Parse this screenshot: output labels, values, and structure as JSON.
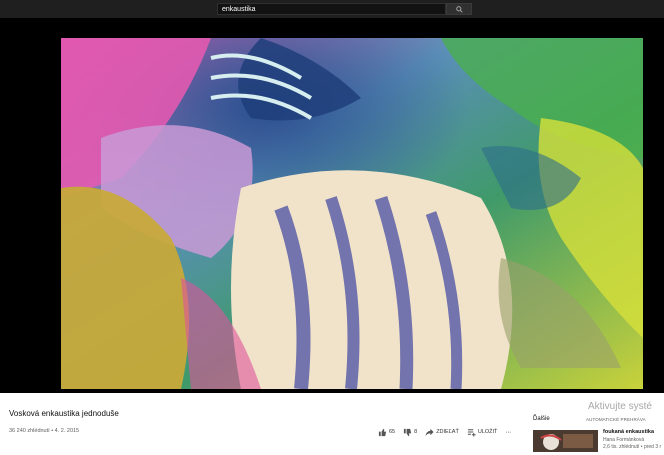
{
  "search": {
    "query": "enkaustika"
  },
  "video": {
    "title": "Vosková enkaustika jednoduše",
    "views_date": "36 240 zhlédnutí • 4. 2. 2015",
    "likes": "65",
    "dislikes": "8",
    "share_label": "ZDIEĽAŤ",
    "save_label": "ULOŽIŤ",
    "more_label": "···"
  },
  "sidebar": {
    "next_label": "Ďalšie",
    "autoplay_label": "AUTOMATICKÉ PREHRÁVA",
    "recommendations": [
      {
        "title": "foukaná enkaustika",
        "channel": "Hana Formánková",
        "meta": "2,6 tis. zhlédnutí • pred 3 r"
      }
    ]
  },
  "watermark": "Aktivujte systé",
  "icons": [
    "search-icon",
    "thumb-up-icon",
    "thumb-down-icon",
    "share-icon",
    "save-playlist-icon",
    "more-icon"
  ]
}
